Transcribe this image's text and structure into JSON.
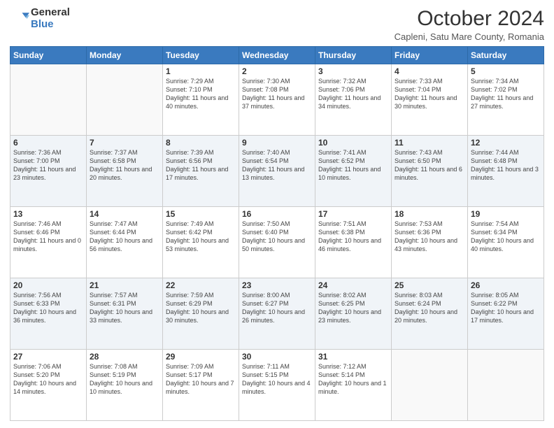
{
  "logo": {
    "general": "General",
    "blue": "Blue"
  },
  "header": {
    "title": "October 2024",
    "subtitle": "Capleni, Satu Mare County, Romania"
  },
  "weekdays": [
    "Sunday",
    "Monday",
    "Tuesday",
    "Wednesday",
    "Thursday",
    "Friday",
    "Saturday"
  ],
  "weeks": [
    [
      {
        "num": "",
        "info": ""
      },
      {
        "num": "",
        "info": ""
      },
      {
        "num": "1",
        "info": "Sunrise: 7:29 AM\nSunset: 7:10 PM\nDaylight: 11 hours and 40 minutes."
      },
      {
        "num": "2",
        "info": "Sunrise: 7:30 AM\nSunset: 7:08 PM\nDaylight: 11 hours and 37 minutes."
      },
      {
        "num": "3",
        "info": "Sunrise: 7:32 AM\nSunset: 7:06 PM\nDaylight: 11 hours and 34 minutes."
      },
      {
        "num": "4",
        "info": "Sunrise: 7:33 AM\nSunset: 7:04 PM\nDaylight: 11 hours and 30 minutes."
      },
      {
        "num": "5",
        "info": "Sunrise: 7:34 AM\nSunset: 7:02 PM\nDaylight: 11 hours and 27 minutes."
      }
    ],
    [
      {
        "num": "6",
        "info": "Sunrise: 7:36 AM\nSunset: 7:00 PM\nDaylight: 11 hours and 23 minutes."
      },
      {
        "num": "7",
        "info": "Sunrise: 7:37 AM\nSunset: 6:58 PM\nDaylight: 11 hours and 20 minutes."
      },
      {
        "num": "8",
        "info": "Sunrise: 7:39 AM\nSunset: 6:56 PM\nDaylight: 11 hours and 17 minutes."
      },
      {
        "num": "9",
        "info": "Sunrise: 7:40 AM\nSunset: 6:54 PM\nDaylight: 11 hours and 13 minutes."
      },
      {
        "num": "10",
        "info": "Sunrise: 7:41 AM\nSunset: 6:52 PM\nDaylight: 11 hours and 10 minutes."
      },
      {
        "num": "11",
        "info": "Sunrise: 7:43 AM\nSunset: 6:50 PM\nDaylight: 11 hours and 6 minutes."
      },
      {
        "num": "12",
        "info": "Sunrise: 7:44 AM\nSunset: 6:48 PM\nDaylight: 11 hours and 3 minutes."
      }
    ],
    [
      {
        "num": "13",
        "info": "Sunrise: 7:46 AM\nSunset: 6:46 PM\nDaylight: 11 hours and 0 minutes."
      },
      {
        "num": "14",
        "info": "Sunrise: 7:47 AM\nSunset: 6:44 PM\nDaylight: 10 hours and 56 minutes."
      },
      {
        "num": "15",
        "info": "Sunrise: 7:49 AM\nSunset: 6:42 PM\nDaylight: 10 hours and 53 minutes."
      },
      {
        "num": "16",
        "info": "Sunrise: 7:50 AM\nSunset: 6:40 PM\nDaylight: 10 hours and 50 minutes."
      },
      {
        "num": "17",
        "info": "Sunrise: 7:51 AM\nSunset: 6:38 PM\nDaylight: 10 hours and 46 minutes."
      },
      {
        "num": "18",
        "info": "Sunrise: 7:53 AM\nSunset: 6:36 PM\nDaylight: 10 hours and 43 minutes."
      },
      {
        "num": "19",
        "info": "Sunrise: 7:54 AM\nSunset: 6:34 PM\nDaylight: 10 hours and 40 minutes."
      }
    ],
    [
      {
        "num": "20",
        "info": "Sunrise: 7:56 AM\nSunset: 6:33 PM\nDaylight: 10 hours and 36 minutes."
      },
      {
        "num": "21",
        "info": "Sunrise: 7:57 AM\nSunset: 6:31 PM\nDaylight: 10 hours and 33 minutes."
      },
      {
        "num": "22",
        "info": "Sunrise: 7:59 AM\nSunset: 6:29 PM\nDaylight: 10 hours and 30 minutes."
      },
      {
        "num": "23",
        "info": "Sunrise: 8:00 AM\nSunset: 6:27 PM\nDaylight: 10 hours and 26 minutes."
      },
      {
        "num": "24",
        "info": "Sunrise: 8:02 AM\nSunset: 6:25 PM\nDaylight: 10 hours and 23 minutes."
      },
      {
        "num": "25",
        "info": "Sunrise: 8:03 AM\nSunset: 6:24 PM\nDaylight: 10 hours and 20 minutes."
      },
      {
        "num": "26",
        "info": "Sunrise: 8:05 AM\nSunset: 6:22 PM\nDaylight: 10 hours and 17 minutes."
      }
    ],
    [
      {
        "num": "27",
        "info": "Sunrise: 7:06 AM\nSunset: 5:20 PM\nDaylight: 10 hours and 14 minutes."
      },
      {
        "num": "28",
        "info": "Sunrise: 7:08 AM\nSunset: 5:19 PM\nDaylight: 10 hours and 10 minutes."
      },
      {
        "num": "29",
        "info": "Sunrise: 7:09 AM\nSunset: 5:17 PM\nDaylight: 10 hours and 7 minutes."
      },
      {
        "num": "30",
        "info": "Sunrise: 7:11 AM\nSunset: 5:15 PM\nDaylight: 10 hours and 4 minutes."
      },
      {
        "num": "31",
        "info": "Sunrise: 7:12 AM\nSunset: 5:14 PM\nDaylight: 10 hours and 1 minute."
      },
      {
        "num": "",
        "info": ""
      },
      {
        "num": "",
        "info": ""
      }
    ]
  ]
}
